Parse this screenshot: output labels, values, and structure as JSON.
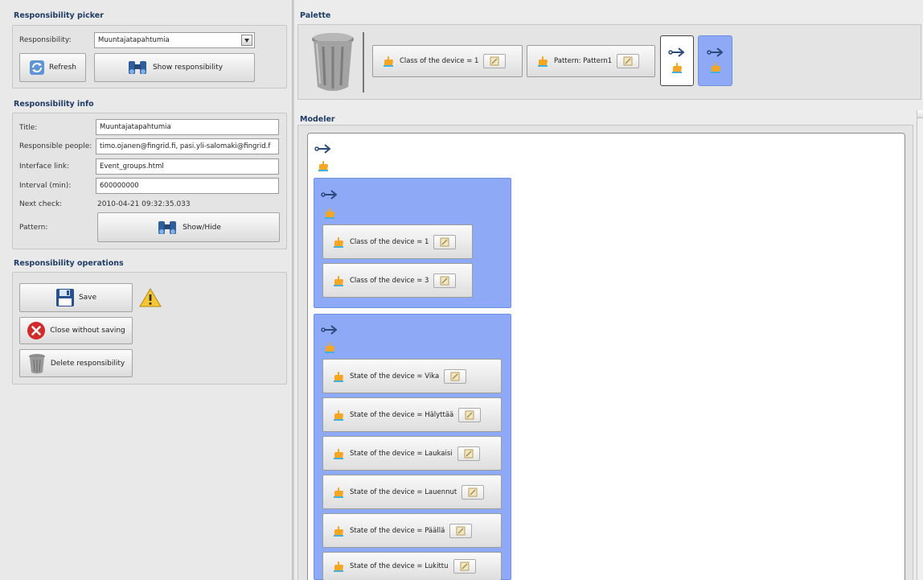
{
  "picker": {
    "title": "Responsibility picker",
    "responsibility_label": "Responsibility:",
    "responsibility_value": "Muuntajatapahtumia",
    "refresh_label": "Refresh",
    "show_label": "Show responsibility"
  },
  "info": {
    "title": "Responsibility info",
    "title_label": "Title:",
    "title_value": "Muuntajatapahtumia",
    "people_label": "Responsible people:",
    "people_value": "timo.ojanen@fingrid.fi, pasi.yli-salomaki@fingrid.f",
    "link_label": "Interface link:",
    "link_value": "Event_groups.html",
    "interval_label": "Interval (min):",
    "interval_value": "600000000",
    "next_label": "Next check:",
    "next_value": "2010-04-21 09:32:35.033",
    "pattern_label": "Pattern:",
    "showhide_label": "Show/Hide"
  },
  "ops": {
    "title": "Responsibility operations",
    "save_label": "Save",
    "close_label": "Close without saving",
    "delete_label": "Delete responsibility"
  },
  "palette": {
    "title": "Palette",
    "items": [
      {
        "label": "Class of the device = 1"
      },
      {
        "label": "Pattern: Pattern1"
      }
    ]
  },
  "modeler": {
    "title": "Modeler",
    "group1": [
      {
        "label": "Class of the device = 1"
      },
      {
        "label": "Class of the device = 3"
      }
    ],
    "group2": [
      {
        "label": "State of the device = Vika"
      },
      {
        "label": "State of the device = Hälyttää"
      },
      {
        "label": "State of the device = Laukaisi"
      },
      {
        "label": "State of the device = Lauennut"
      },
      {
        "label": "State of the device = Päällä"
      },
      {
        "label": "State of the device = Lukittu"
      }
    ]
  },
  "colors": {
    "section_title": "#1f3c66",
    "group_blue": "#8eaaf6",
    "arrow": "#2c4a7c",
    "hand": "#f5a623"
  }
}
